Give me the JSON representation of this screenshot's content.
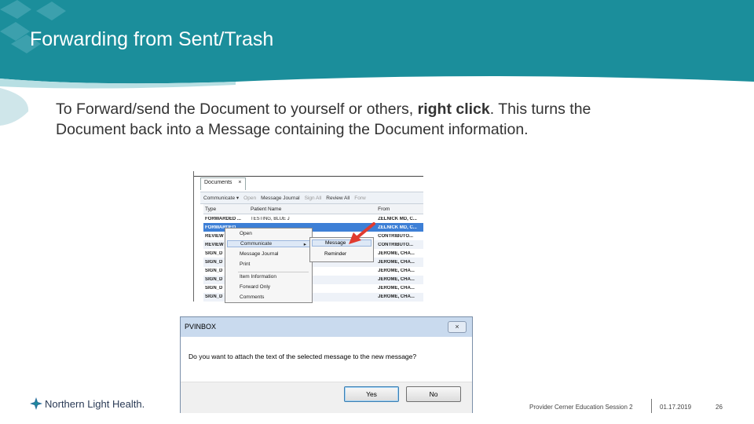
{
  "slide": {
    "title": "Forwarding from Sent/Trash",
    "body_pre": "To Forward/send the Document to yourself or others, ",
    "body_bold": "right click",
    "body_post": ". This turns the Document back into a Message containing the Document information."
  },
  "documents_window": {
    "tab_label": "Documents",
    "tab_close": "×",
    "toolbar": [
      "Communicate ▾",
      "Open",
      "Message Journal",
      "Sign All",
      "Review All",
      "Forw"
    ],
    "columns": [
      "Type",
      "Patient Name",
      "From"
    ],
    "rows": [
      {
        "type": "FORWARDED ...",
        "patient": "TESTING, BLUE J",
        "from": "ZELNICK MD, C..."
      },
      {
        "type": "FORWARDED ...",
        "patient": "",
        "from": "ZELNICK MD, C..."
      },
      {
        "type": "REVIEW",
        "patient": "",
        "from": "CONTRIBUTO..."
      },
      {
        "type": "REVIEW",
        "patient": "",
        "from": "CONTRIBUTO..."
      },
      {
        "type": "SIGN_D",
        "patient": "",
        "from": "JEROME, CHA..."
      },
      {
        "type": "SIGN_D",
        "patient": "",
        "from": "JEROME, CHA..."
      },
      {
        "type": "SIGN_D",
        "patient": "",
        "from": "JEROME, CHA..."
      },
      {
        "type": "SIGN_D",
        "patient": "",
        "from": "JEROME, CHA..."
      },
      {
        "type": "SIGN_D",
        "patient": "",
        "from": "JEROME, CHA..."
      },
      {
        "type": "SIGN_D",
        "patient": "",
        "from": "JEROME, CHA..."
      }
    ],
    "context_menu": [
      "Open",
      "Communicate",
      "Message Journal",
      "Print",
      "Item Information",
      "Forward Only",
      "Comments"
    ],
    "submenu": [
      "Message",
      "Reminder"
    ],
    "submenu_arrow": "▸"
  },
  "dialog": {
    "title": "PVINBOX",
    "close": "×",
    "message": "Do you want to attach the text of the selected message to the new message?",
    "yes_label": "Yes",
    "no_label": "No"
  },
  "footer": {
    "logo_text": "Northern Light Health.",
    "session": "Provider Cerner Education Session 2",
    "date": "01.17.2019",
    "page": "26"
  },
  "colors": {
    "banner": "#1b8e9b",
    "banner_light": "#7cc4cd",
    "selection": "#3d7fd6",
    "arrow": "#e03b2f"
  }
}
